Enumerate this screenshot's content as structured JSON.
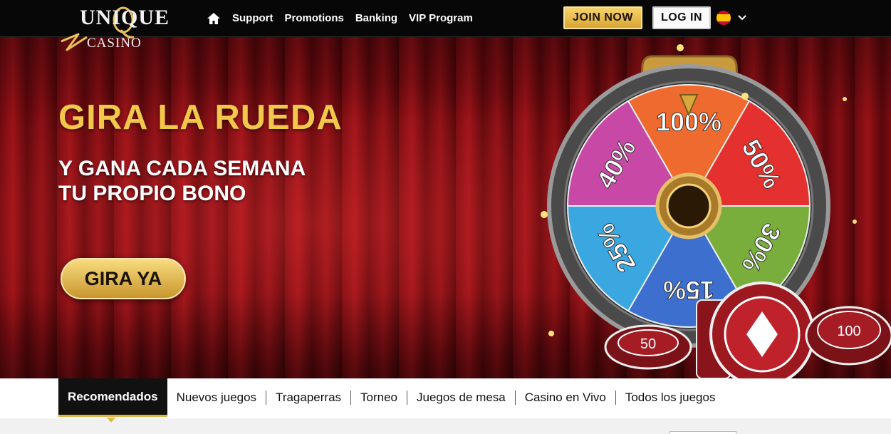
{
  "brand": {
    "logo_top": "UNIQUE",
    "logo_bottom": "CASINO"
  },
  "nav": {
    "home_icon": "home-icon",
    "links": [
      "Support",
      "Promotions",
      "Banking",
      "VIP Program"
    ]
  },
  "header": {
    "join_label": "JOIN NOW",
    "login_label": "LOG IN",
    "language_flag": "spain-flag-icon",
    "language_caret": "chevron-down-icon"
  },
  "hero": {
    "title": "GIRA LA RUEDA",
    "subtitle_line1": "Y GANA CADA SEMANA",
    "subtitle_line2": "TU PROPIO BONO",
    "cta_label": "GIRA YA",
    "wheel_segments": [
      "100%",
      "50%",
      "30%",
      "15%",
      "25%",
      "40%"
    ],
    "wheel_colors": [
      "#ee6a2e",
      "#e4312f",
      "#79ad3c",
      "#3c6fce",
      "#3aa7e0",
      "#c848a6"
    ],
    "chips": [
      "50",
      "100"
    ]
  },
  "categories": {
    "items": [
      "Recomendados",
      "Nuevos juegos",
      "Tragaperras",
      "Torneo",
      "Juegos de mesa",
      "Casino en Vivo",
      "Todos los juegos"
    ],
    "active_index": 0
  },
  "colors": {
    "gold": "#f1c84a",
    "accent": "#e0b543",
    "curtain": "#8a0f15"
  }
}
